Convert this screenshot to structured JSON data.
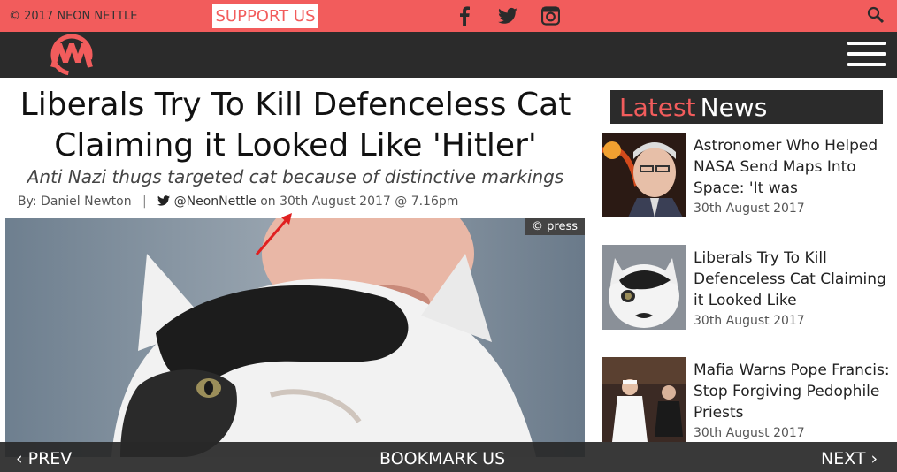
{
  "topbar": {
    "copyright": "© 2017 NEON NETTLE",
    "support_label": "SUPPORT US",
    "social": [
      "facebook-icon",
      "twitter-icon",
      "instagram-icon"
    ]
  },
  "article": {
    "title": "Liberals Try To Kill Defenceless Cat Claiming it Looked Like 'Hitler'",
    "subtitle": "Anti Nazi thugs targeted cat because of distinctive markings",
    "by": "By: Daniel Newton",
    "handle": "@NeonNettle",
    "date": "on 30th August 2017 @ 7.16pm",
    "photo_credit": "© press"
  },
  "sidebar": {
    "heading_part1": "Latest",
    "heading_part2": "News",
    "items": [
      {
        "title": "Astronomer Who Helped NASA Send Maps Into Space: 'It was",
        "date": "30th August 2017"
      },
      {
        "title": "Liberals Try To Kill Defenceless Cat Claiming it Looked Like",
        "date": "30th August 2017"
      },
      {
        "title": "Mafia Warns Pope Francis: Stop Forgiving Pedophile Priests",
        "date": "30th August 2017"
      }
    ]
  },
  "bottombar": {
    "prev": "‹ PREV",
    "bookmark": "BOOKMARK US",
    "next": "NEXT ›"
  },
  "colors": {
    "accent": "#f25c5c",
    "dark": "#2b2b2b"
  }
}
